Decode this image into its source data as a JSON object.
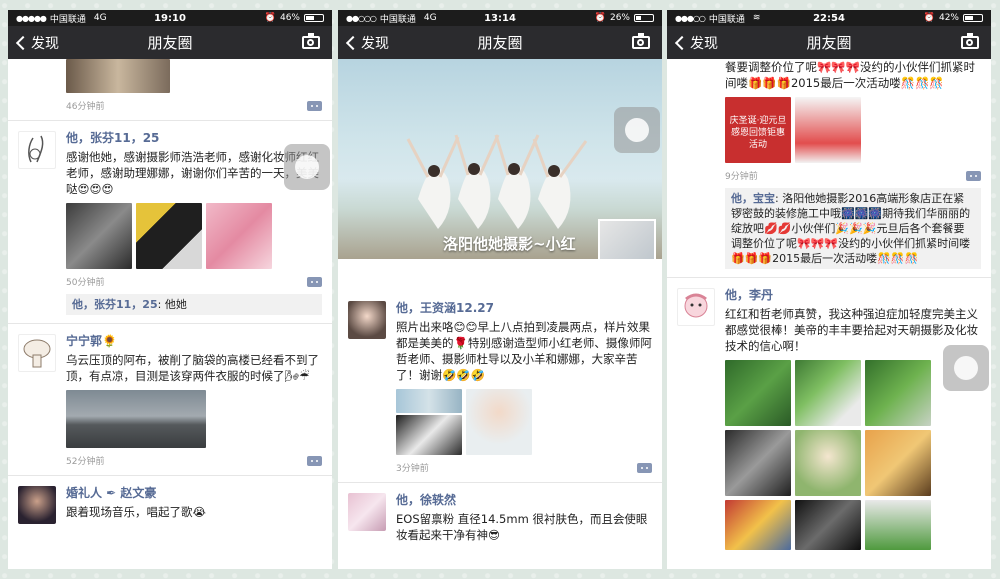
{
  "panels": [
    {
      "status": {
        "carrier": "中国联通",
        "net": "4G",
        "time": "19:10",
        "battery": "46%",
        "battery_level": 0.46
      },
      "nav": {
        "back": "发现",
        "title": "朋友圈"
      },
      "partial_post": {
        "ago": "46分钟前"
      },
      "posts": [
        {
          "name": "他，张芬11，25",
          "text": "感谢他她，感谢摄影师浩浩老师，感谢化妆师红红老师，感谢助理娜娜，谢谢你们辛苦的一天，美美哒😍😍😍",
          "ago": "50分钟前",
          "reply_name": "他，张芬11，25",
          "reply_text": ": 他她"
        },
        {
          "name": "宁宁郭🌻",
          "text": "乌云压顶的阿布，被削了脑袋的高楼已经看不到了顶，有点凉，目测是该穿两件衣服的时候了🌬☔",
          "ago": "52分钟前"
        },
        {
          "name": "婚礼人 ✒ 赵文豪",
          "text": "跟着现场音乐，唱起了歌😭"
        }
      ]
    },
    {
      "status": {
        "carrier": "中国联通",
        "net": "4G",
        "time": "13:14",
        "battery": "26%",
        "battery_level": 0.26
      },
      "nav": {
        "back": "发现",
        "title": "朋友圈"
      },
      "cover_title": "洛阳他她摄影~小红",
      "posts": [
        {
          "name": "他，王资涵12.27",
          "text": "照片出来咯😊😊早上八点拍到凌晨两点，样片效果都是美美的🌹特别感谢造型师小红老师、摄像师阿哲老师、摄影师杜导以及小羊和娜娜，大家辛苦了！谢谢🤣🤣🤣",
          "ago": "3分钟前"
        },
        {
          "name": "他，徐轶然",
          "text": "EOS留禀粉 直径14.5mm 很衬肤色，而且会使眼妆看起来干净有神😎"
        }
      ]
    },
    {
      "status": {
        "carrier": "中国联通",
        "net": "",
        "time": "22:54",
        "battery": "42%",
        "battery_level": 0.42
      },
      "nav": {
        "back": "发现",
        "title": "朋友圈"
      },
      "top_post": {
        "text": "餐要调整价位了呢🎀🎀🎀没约的小伙伴们抓紧时间喽🎁🎁🎁2015最后一次活动喽🎊🎊🎊",
        "promo_text": "庆圣诞·迎元旦 感恩回馈钜惠活动",
        "ago": "9分钟前",
        "reply_name": "他，宝宝",
        "reply_text": ": 洛阳他她摄影2016高端形象店正在紧锣密鼓的装修施工中哦🎆🎆🎆期待我们华丽丽的绽放吧💋💋小伙伴们🎉🎉🎉元旦后各个套餐要调整价位了呢🎀🎀🎀没约的小伙伴们抓紧时间喽🎁🎁🎁2015最后一次活动喽🎊🎊🎊"
      },
      "posts": [
        {
          "name": "他，李丹",
          "text": "红红和哲老师真赞，我这种强迫症加轻度完美主义都感觉很棒！美帝的丰丰要拾起对天朝摄影及化妆技术的信心啊！"
        }
      ]
    }
  ]
}
